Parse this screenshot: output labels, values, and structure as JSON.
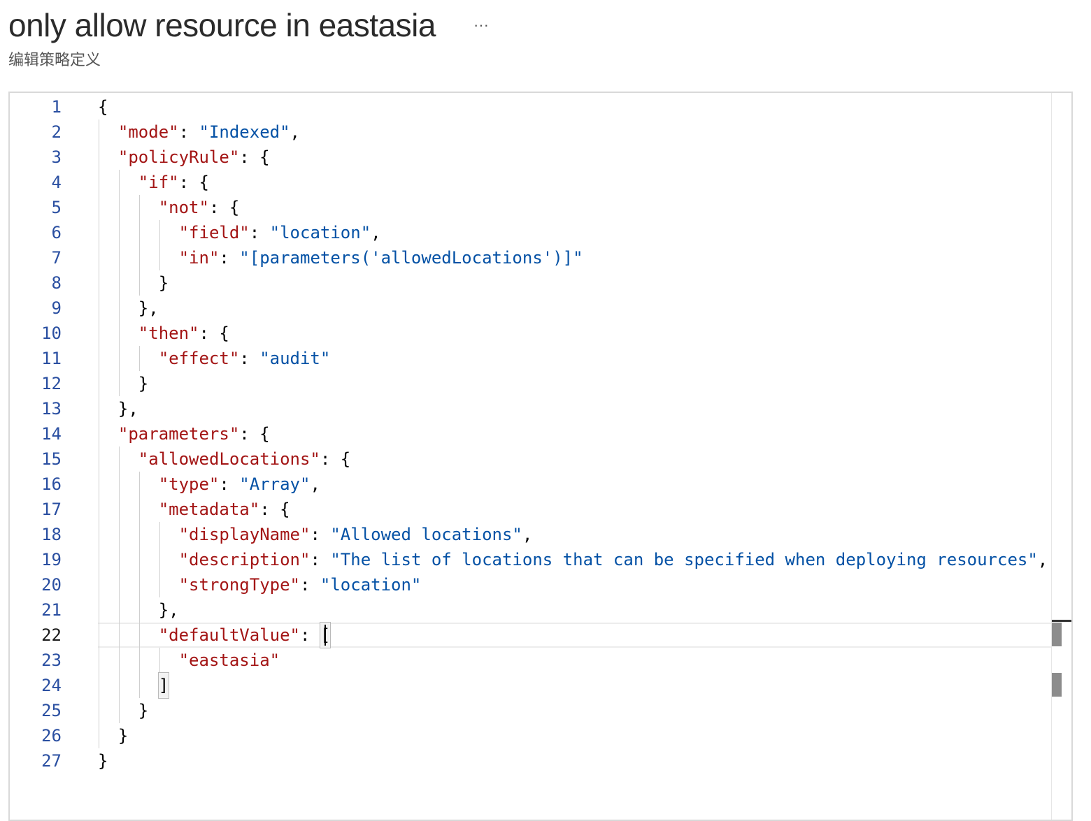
{
  "header": {
    "title": "only allow resource in eastasia",
    "more_label": "···",
    "subtitle": "编辑策略定义"
  },
  "editor": {
    "active_line": 22,
    "lines": [
      {
        "num": "1",
        "indent": 0,
        "tokens": [
          {
            "t": "p",
            "v": "{"
          }
        ]
      },
      {
        "num": "2",
        "indent": 1,
        "tokens": [
          {
            "t": "k",
            "v": "\"mode\""
          },
          {
            "t": "p",
            "v": ": "
          },
          {
            "t": "s",
            "v": "\"Indexed\""
          },
          {
            "t": "p",
            "v": ","
          }
        ]
      },
      {
        "num": "3",
        "indent": 1,
        "tokens": [
          {
            "t": "k",
            "v": "\"policyRule\""
          },
          {
            "t": "p",
            "v": ": {"
          }
        ]
      },
      {
        "num": "4",
        "indent": 2,
        "tokens": [
          {
            "t": "k",
            "v": "\"if\""
          },
          {
            "t": "p",
            "v": ": {"
          }
        ]
      },
      {
        "num": "5",
        "indent": 3,
        "tokens": [
          {
            "t": "k",
            "v": "\"not\""
          },
          {
            "t": "p",
            "v": ": {"
          }
        ]
      },
      {
        "num": "6",
        "indent": 4,
        "tokens": [
          {
            "t": "k",
            "v": "\"field\""
          },
          {
            "t": "p",
            "v": ": "
          },
          {
            "t": "s",
            "v": "\"location\""
          },
          {
            "t": "p",
            "v": ","
          }
        ]
      },
      {
        "num": "7",
        "indent": 4,
        "tokens": [
          {
            "t": "k",
            "v": "\"in\""
          },
          {
            "t": "p",
            "v": ": "
          },
          {
            "t": "s",
            "v": "\"[parameters('allowedLocations')]\""
          }
        ]
      },
      {
        "num": "8",
        "indent": 3,
        "tokens": [
          {
            "t": "p",
            "v": "}"
          }
        ]
      },
      {
        "num": "9",
        "indent": 2,
        "tokens": [
          {
            "t": "p",
            "v": "},"
          }
        ]
      },
      {
        "num": "10",
        "indent": 2,
        "tokens": [
          {
            "t": "k",
            "v": "\"then\""
          },
          {
            "t": "p",
            "v": ": {"
          }
        ]
      },
      {
        "num": "11",
        "indent": 3,
        "tokens": [
          {
            "t": "k",
            "v": "\"effect\""
          },
          {
            "t": "p",
            "v": ": "
          },
          {
            "t": "s",
            "v": "\"audit\""
          }
        ]
      },
      {
        "num": "12",
        "indent": 2,
        "tokens": [
          {
            "t": "p",
            "v": "}"
          }
        ]
      },
      {
        "num": "13",
        "indent": 1,
        "tokens": [
          {
            "t": "p",
            "v": "},"
          }
        ]
      },
      {
        "num": "14",
        "indent": 1,
        "tokens": [
          {
            "t": "k",
            "v": "\"parameters\""
          },
          {
            "t": "p",
            "v": ": {"
          }
        ]
      },
      {
        "num": "15",
        "indent": 2,
        "tokens": [
          {
            "t": "k",
            "v": "\"allowedLocations\""
          },
          {
            "t": "p",
            "v": ": {"
          }
        ]
      },
      {
        "num": "16",
        "indent": 3,
        "tokens": [
          {
            "t": "k",
            "v": "\"type\""
          },
          {
            "t": "p",
            "v": ": "
          },
          {
            "t": "s",
            "v": "\"Array\""
          },
          {
            "t": "p",
            "v": ","
          }
        ]
      },
      {
        "num": "17",
        "indent": 3,
        "tokens": [
          {
            "t": "k",
            "v": "\"metadata\""
          },
          {
            "t": "p",
            "v": ": {"
          }
        ]
      },
      {
        "num": "18",
        "indent": 4,
        "tokens": [
          {
            "t": "k",
            "v": "\"displayName\""
          },
          {
            "t": "p",
            "v": ": "
          },
          {
            "t": "s",
            "v": "\"Allowed locations\""
          },
          {
            "t": "p",
            "v": ","
          }
        ]
      },
      {
        "num": "19",
        "indent": 4,
        "tokens": [
          {
            "t": "k",
            "v": "\"description\""
          },
          {
            "t": "p",
            "v": ": "
          },
          {
            "t": "s",
            "v": "\"The list of locations that can be specified when deploying resources\""
          },
          {
            "t": "p",
            "v": ","
          }
        ]
      },
      {
        "num": "20",
        "indent": 4,
        "tokens": [
          {
            "t": "k",
            "v": "\"strongType\""
          },
          {
            "t": "p",
            "v": ": "
          },
          {
            "t": "s",
            "v": "\"location\""
          }
        ]
      },
      {
        "num": "21",
        "indent": 3,
        "tokens": [
          {
            "t": "p",
            "v": "},"
          }
        ]
      },
      {
        "num": "22",
        "indent": 3,
        "tokens": [
          {
            "t": "k",
            "v": "\"defaultValue\""
          },
          {
            "t": "p",
            "v": ": "
          },
          {
            "t": "b",
            "v": "["
          }
        ]
      },
      {
        "num": "23",
        "indent": 4,
        "tokens": [
          {
            "t": "k",
            "v": "\"eastasia\""
          }
        ]
      },
      {
        "num": "24",
        "indent": 3,
        "tokens": [
          {
            "t": "b",
            "v": "]"
          }
        ]
      },
      {
        "num": "25",
        "indent": 2,
        "tokens": [
          {
            "t": "p",
            "v": "}"
          }
        ]
      },
      {
        "num": "26",
        "indent": 1,
        "tokens": [
          {
            "t": "p",
            "v": "}"
          }
        ]
      },
      {
        "num": "27",
        "indent": 0,
        "tokens": [
          {
            "t": "p",
            "v": "}"
          }
        ]
      }
    ]
  },
  "colors": {
    "key": "#a31515",
    "string": "#0451a5",
    "line_number": "#2a4fa1"
  }
}
